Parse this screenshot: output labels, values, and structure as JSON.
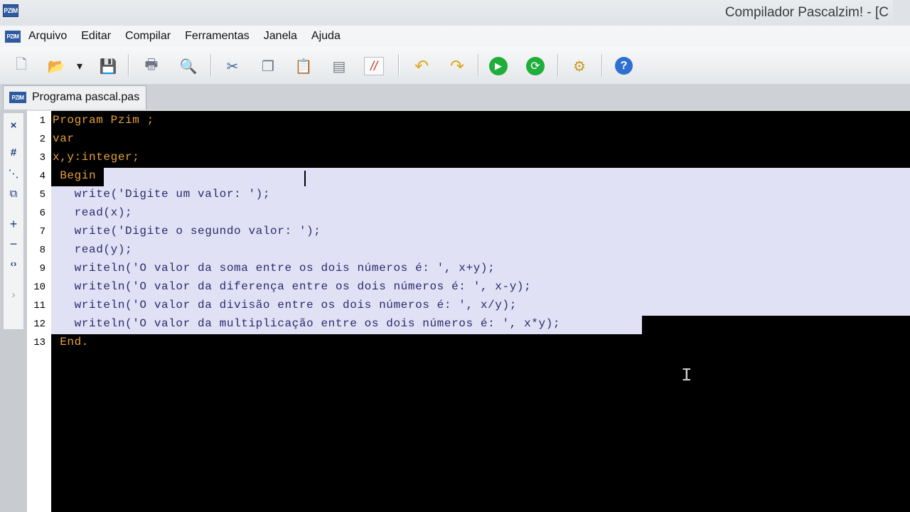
{
  "window": {
    "title": "Compilador Pascalzim! - [C",
    "app_icon": "PZIM"
  },
  "menu": {
    "icon": "PZIM",
    "items": [
      "Arquivo",
      "Editar",
      "Compilar",
      "Ferramentas",
      "Janela",
      "Ajuda"
    ]
  },
  "toolbar": {
    "buttons": [
      {
        "name": "new-file-icon",
        "glyph": "🗋"
      },
      {
        "name": "open-folder-icon",
        "glyph": "📂"
      },
      {
        "name": "dropdown-arrow-icon",
        "glyph": "▾"
      },
      {
        "name": "save-icon",
        "glyph": "💾"
      },
      {
        "name": "print-icon",
        "glyph": "🖶"
      },
      {
        "name": "print-preview-icon",
        "glyph": "🔍"
      },
      {
        "name": "cut-icon",
        "glyph": "✂"
      },
      {
        "name": "copy-icon",
        "glyph": "❐"
      },
      {
        "name": "paste-icon",
        "glyph": "📋"
      },
      {
        "name": "select-all-icon",
        "glyph": "▤"
      },
      {
        "name": "comment-icon",
        "glyph": "//"
      },
      {
        "name": "undo-icon",
        "glyph": "↶"
      },
      {
        "name": "redo-icon",
        "glyph": "↷"
      },
      {
        "name": "run-icon",
        "glyph": "▶"
      },
      {
        "name": "step-run-icon",
        "glyph": "⟳"
      },
      {
        "name": "settings-icon",
        "glyph": "⚙"
      },
      {
        "name": "help-icon",
        "glyph": "?"
      }
    ]
  },
  "tabs": [
    {
      "label": "Programa pascal.pas",
      "icon": "PZIM",
      "active": true
    }
  ],
  "side_tools": [
    {
      "name": "close-icon",
      "glyph": "×"
    },
    {
      "name": "hash-icon",
      "glyph": "#"
    },
    {
      "name": "indent-icon",
      "glyph": "⋱"
    },
    {
      "name": "window-icon",
      "glyph": "⧉"
    },
    {
      "name": "expand-icon",
      "glyph": "+"
    },
    {
      "name": "collapse-icon",
      "glyph": "−"
    },
    {
      "name": "brackets-icon",
      "glyph": "‹›"
    },
    {
      "name": "arrow-right-icon",
      "glyph": "›"
    }
  ],
  "editor": {
    "colors": {
      "background": "#000000",
      "code": "#e8a23a",
      "selected_code": "#2a2a6c",
      "selection": "#e1e1f5",
      "plain": "#ffffff"
    },
    "lines": [
      {
        "n": "1",
        "text": "Program Pzim ;"
      },
      {
        "n": "2",
        "text": "var"
      },
      {
        "n": "3",
        "text": "x,y:integer;"
      },
      {
        "n": "4",
        "text": " Begin"
      },
      {
        "n": "5",
        "text": "   write('Digite um valor: ');"
      },
      {
        "n": "6",
        "text": "   read(x);"
      },
      {
        "n": "7",
        "text": "   write('Digite o segundo valor: ');"
      },
      {
        "n": "8",
        "text": "   read(y);"
      },
      {
        "n": "9",
        "text": "   writeln('O valor da soma entre os dois números é: ', x+y);"
      },
      {
        "n": "10",
        "text": "   writeln('O valor da diferença entre os dois números é: ', x-y);"
      },
      {
        "n": "11",
        "text": "   writeln('O valor da divisão entre os dois números é: ', x/y);"
      },
      {
        "n": "12",
        "text": "   writeln('O valor da multiplicação entre os dois números é: ', x*y);"
      },
      {
        "n": "13",
        "text": " End."
      }
    ]
  }
}
